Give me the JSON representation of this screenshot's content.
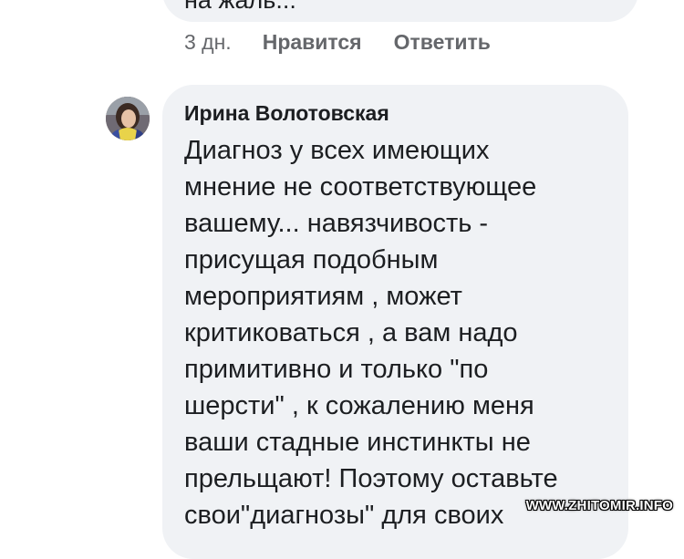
{
  "previous_comment": {
    "text_fragment": "на жаль...",
    "time": "3 дн.",
    "like_label": "Нравится",
    "reply_label": "Ответить"
  },
  "comment": {
    "author": "Ирина Волотовская",
    "lines": [
      "Диагноз у всех имеющих",
      "мнение не соответствующее",
      "вашему... навязчивость -",
      "присущая подобным",
      "мероприятиям , может",
      "критиковаться , а вам надо",
      "примитивно и только \"по",
      "шерсти\" , к сожалению меня",
      "ваши стадные инстинкты не",
      "прельщают! Поэтому оставьте",
      "свои\"диагнозы\" для своих"
    ]
  },
  "watermark": "WWW.ZHITOMIR.INFO",
  "colors": {
    "bubble": "#f0f2f5",
    "meta_text": "#65676b",
    "text": "#1c1e21"
  },
  "icons": [
    "avatar"
  ]
}
